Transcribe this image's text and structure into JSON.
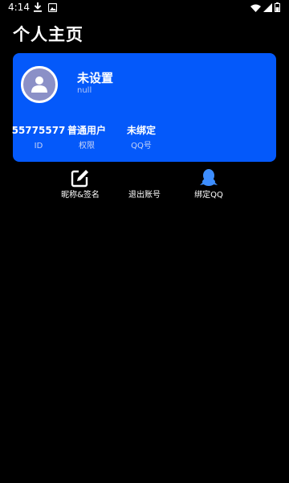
{
  "status_bar": {
    "time": "4:14",
    "icons": [
      "download-icon",
      "image-icon",
      "wifi-icon",
      "signal-icon",
      "battery-icon"
    ]
  },
  "page": {
    "title": "个人主页"
  },
  "profile": {
    "nickname": "未设置",
    "signature": "null",
    "avatar_icon": "person-icon",
    "stats": [
      {
        "value": "55775577",
        "label": "ID"
      },
      {
        "value": "普通用户",
        "label": "权限"
      },
      {
        "value": "未绑定",
        "label": "QQ号"
      }
    ]
  },
  "actions": [
    {
      "label": "昵称&签名",
      "icon": "edit-icon"
    },
    {
      "label": "退出账号",
      "icon": ""
    },
    {
      "label": "绑定QQ",
      "icon": "qq-penguin-icon"
    }
  ],
  "colors": {
    "background": "#000000",
    "card": "#0459fa",
    "avatar": "#8b90c7",
    "qq_icon": "#3d8eff"
  }
}
